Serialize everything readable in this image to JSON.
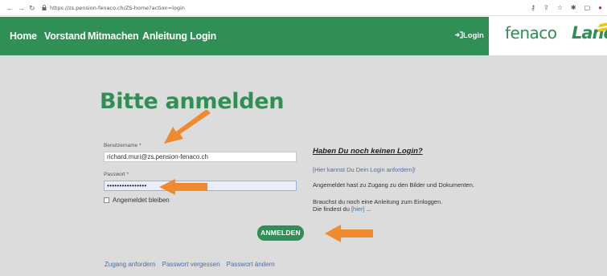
{
  "browser": {
    "url": "https://zs.pension-fenaco.ch/ZS-home?action=login"
  },
  "nav": {
    "items": [
      "Home",
      "Vorstand",
      "Mitmachen",
      "Anleitung Login"
    ],
    "login_label": "Login"
  },
  "logos": {
    "fenaco": "fenaco",
    "landi": "Landi"
  },
  "login": {
    "title": "Bitte anmelden",
    "username_label": "Benutzername *",
    "username_value": "richard.muri@zs.pension-fenaco.ch",
    "password_label": "Passwort *",
    "password_value": "••••••••••••••••",
    "remember_label": "Angemeldet bleiben",
    "submit_label": "ANMELDEN"
  },
  "links": {
    "request_access": "Zugang anfordern",
    "forgot_password": "Passwort vergessen",
    "change_password": "Passwort ändern"
  },
  "hint": {
    "title": "Haben Du noch keinen Login?",
    "request_link": "[Hier kannst Du Dein Login anfordern]!",
    "info_access": "Angemeldet hast zu Zugang zu den Bilder und Dokumenten.",
    "info_guide_1": "Brauchst du noch eine Anleitung zum Einloggen.",
    "info_guide_2_prefix": "Die findest du ",
    "info_guide_2_link": "[hier]",
    "info_guide_2_suffix": " ..."
  },
  "colors": {
    "brand_green": "#2f8f55",
    "annotation_orange": "#f08a2e",
    "content_bg": "#dcdcdc"
  }
}
